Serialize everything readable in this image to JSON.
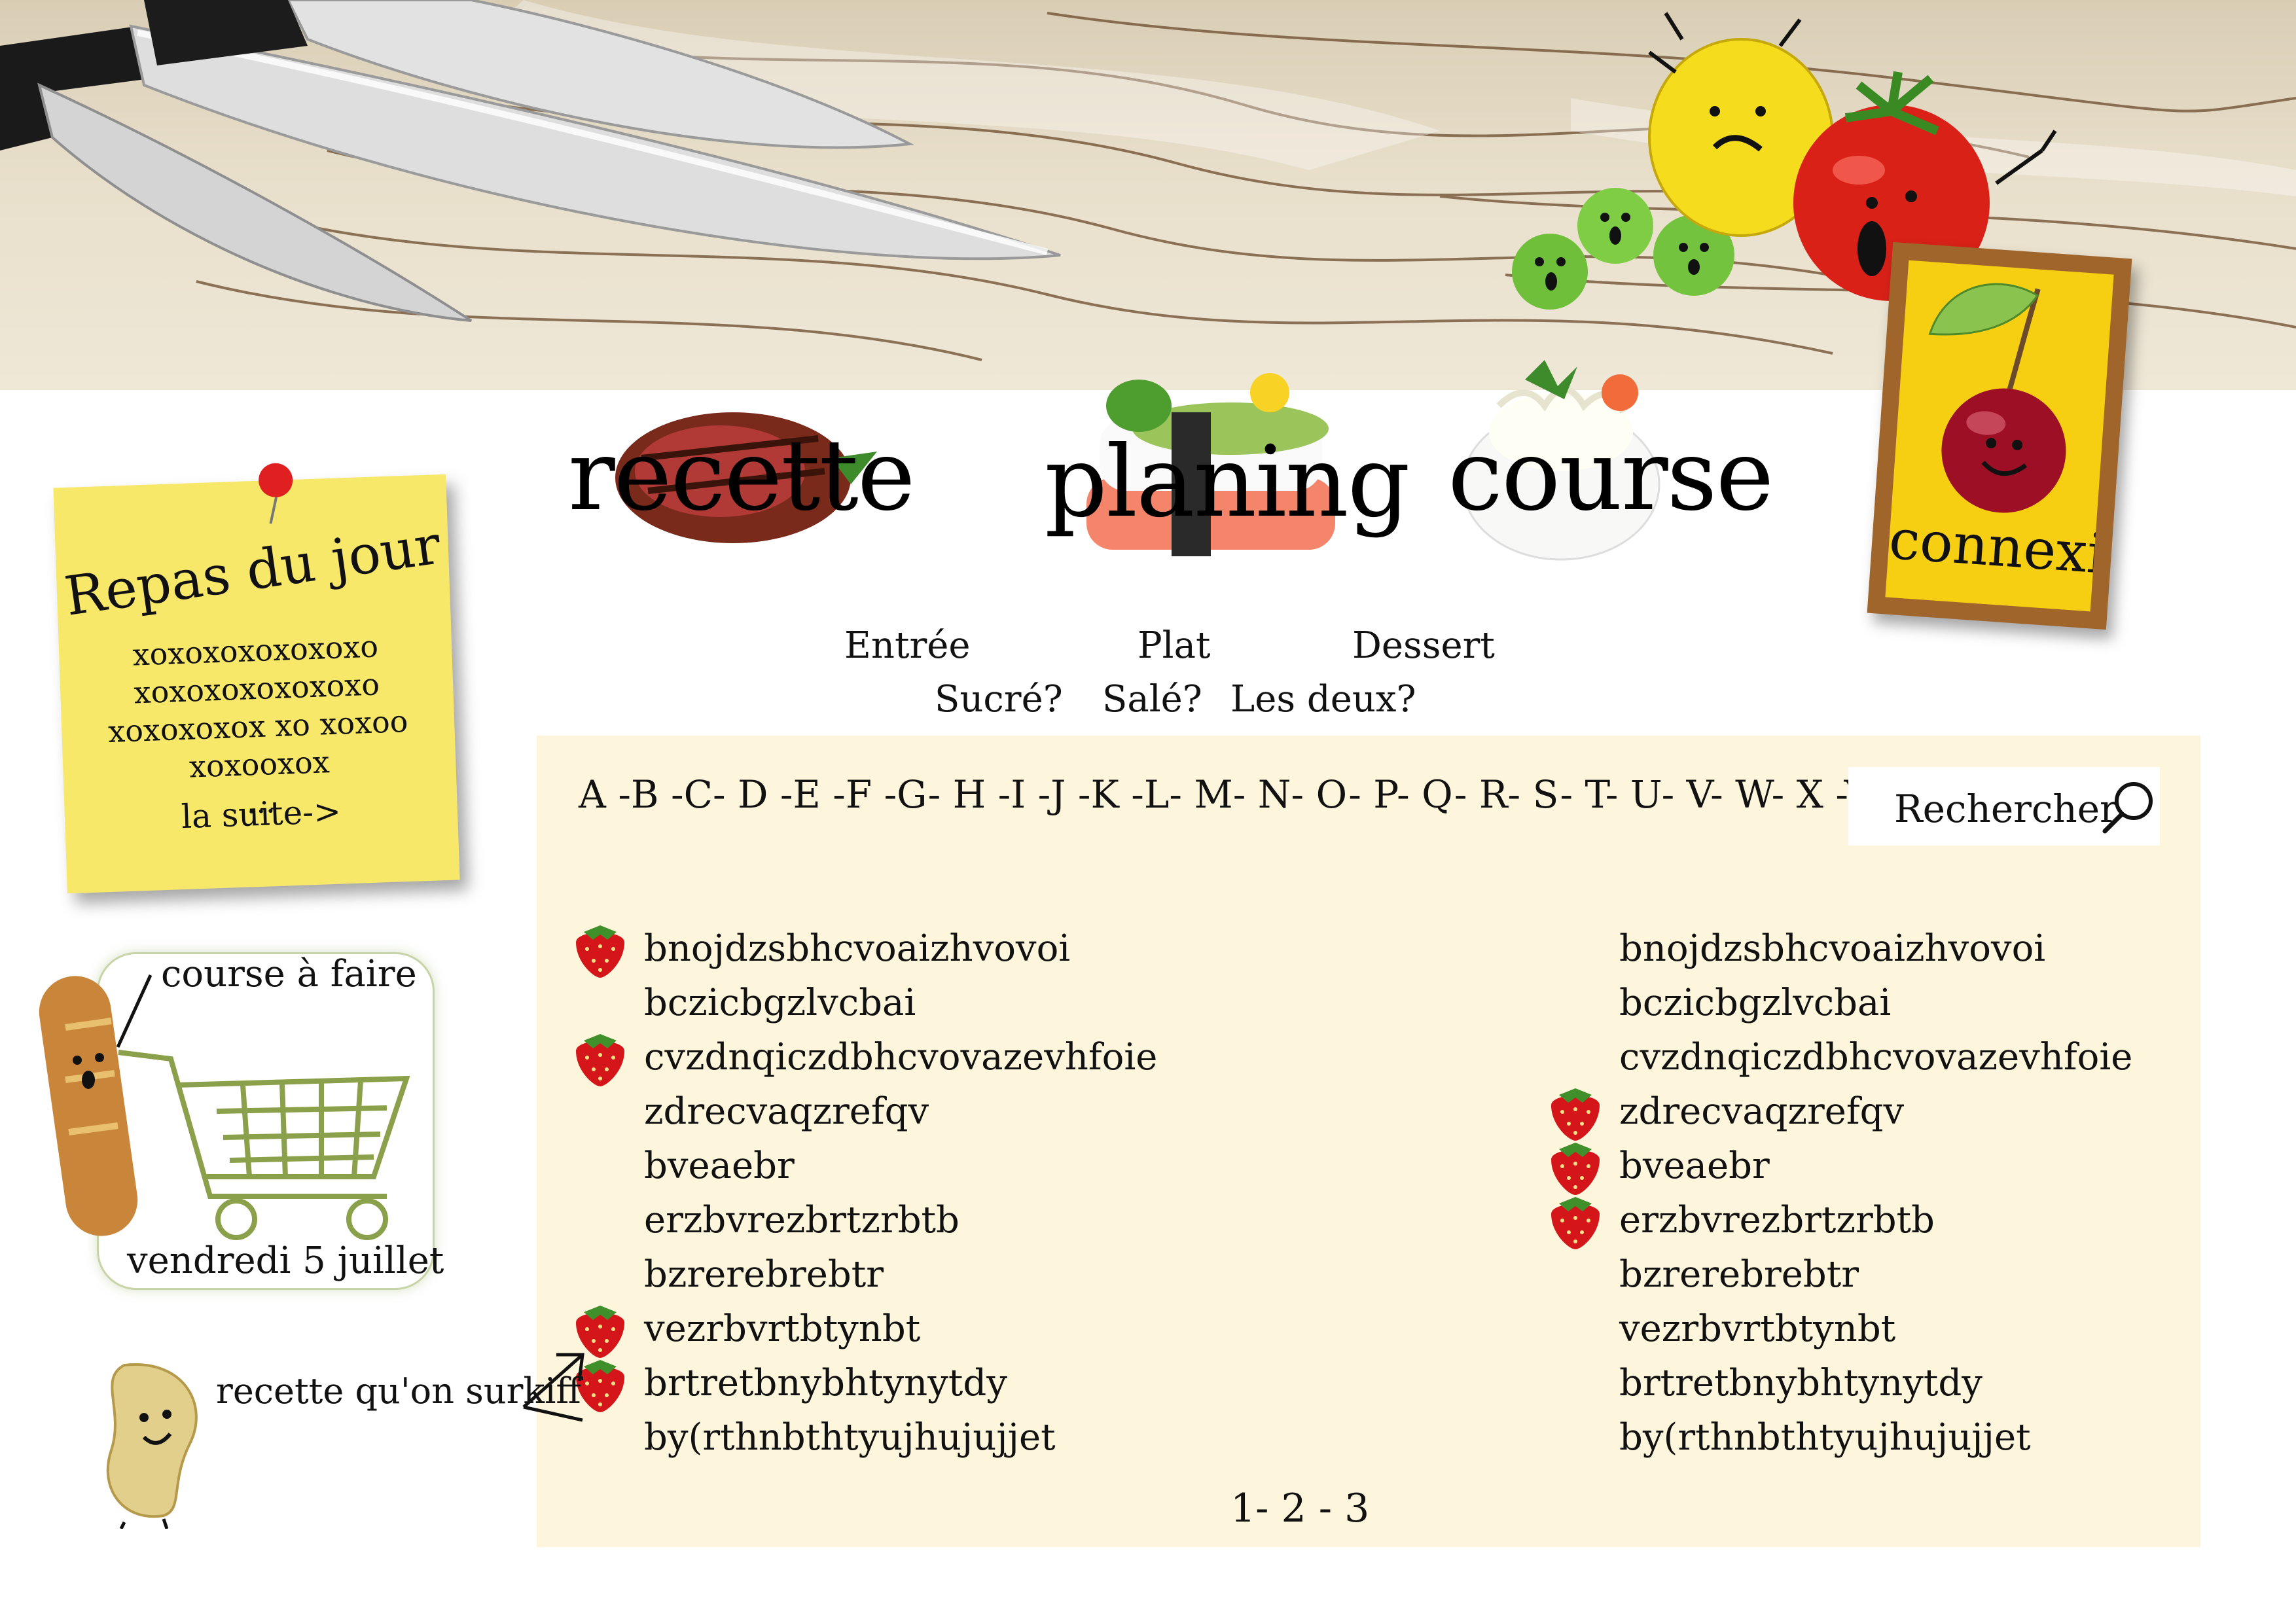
{
  "nav": {
    "recette": "recette",
    "planing": "planing",
    "course": "course",
    "connexion": "connexion"
  },
  "post_it": {
    "title": "Repas du jour",
    "lines": [
      "xoxoxoxoxoxoxo",
      "xoxoxoxoxoxoxo",
      "xoxoxoxox xo xoxoo",
      "xoxooxox"
    ],
    "ellipsis": "...",
    "more": "la suite->"
  },
  "categories": {
    "type": [
      "Entrée",
      "Plat",
      "Dessert"
    ],
    "taste": [
      "Sucré?",
      "Salé?",
      "Les deux?"
    ]
  },
  "alphabet": "A -B -C- D -E -F -G- H -I -J -K -L- M- N- O- P- Q- R- S- T- U- V- W- X -Y- Z",
  "search": {
    "label": "Rechercher",
    "icon": "search-icon"
  },
  "recipes_left": [
    {
      "name": "bnojdzsbhcvoaizhvovoi",
      "favorite": true
    },
    {
      "name": "bczicbgzlvcbai",
      "favorite": false
    },
    {
      "name": "cvzdnqiczdbhcvovazevhfoie",
      "favorite": true
    },
    {
      "name": "zdrecvaqzrefqv",
      "favorite": false
    },
    {
      "name": "bveaebr",
      "favorite": false
    },
    {
      "name": "erzbvrezbrtzrbtb",
      "favorite": false
    },
    {
      "name": "bzrerebrebtr",
      "favorite": false
    },
    {
      "name": "vezrbvrtbtynbt",
      "favorite": true
    },
    {
      "name": "brtretbnybhtynytdy",
      "favorite": true
    },
    {
      "name": "by(rthnbthtyujhujujjet",
      "favorite": false
    }
  ],
  "recipes_right": [
    {
      "name": "bnojdzsbhcvoaizhvovoi",
      "favorite": false
    },
    {
      "name": "bczicbgzlvcbai",
      "favorite": false
    },
    {
      "name": "cvzdnqiczdbhcvovazevhfoie",
      "favorite": false
    },
    {
      "name": "zdrecvaqzrefqv",
      "favorite": true
    },
    {
      "name": "bveaebr",
      "favorite": true
    },
    {
      "name": "erzbvrezbrtzrbtb",
      "favorite": true
    },
    {
      "name": "bzrerebrebtr",
      "favorite": false
    },
    {
      "name": "vezrbvrtbtynbt",
      "favorite": false
    },
    {
      "name": "brtretbnybhtynytdy",
      "favorite": false
    },
    {
      "name": "by(rthnbthtyujhujujjet",
      "favorite": false
    }
  ],
  "pagination": "1-  2 - 3",
  "shopping": {
    "label": "course à faire",
    "date": "vendredi 5 juillet"
  },
  "favorites_label": "recette qu'on surkiff",
  "colors": {
    "panel": "#fdf6dc",
    "postit": "#f8e86a",
    "frame": "#a0652a",
    "frame_inner": "#f7cf12",
    "cart": "#8aa04a"
  }
}
